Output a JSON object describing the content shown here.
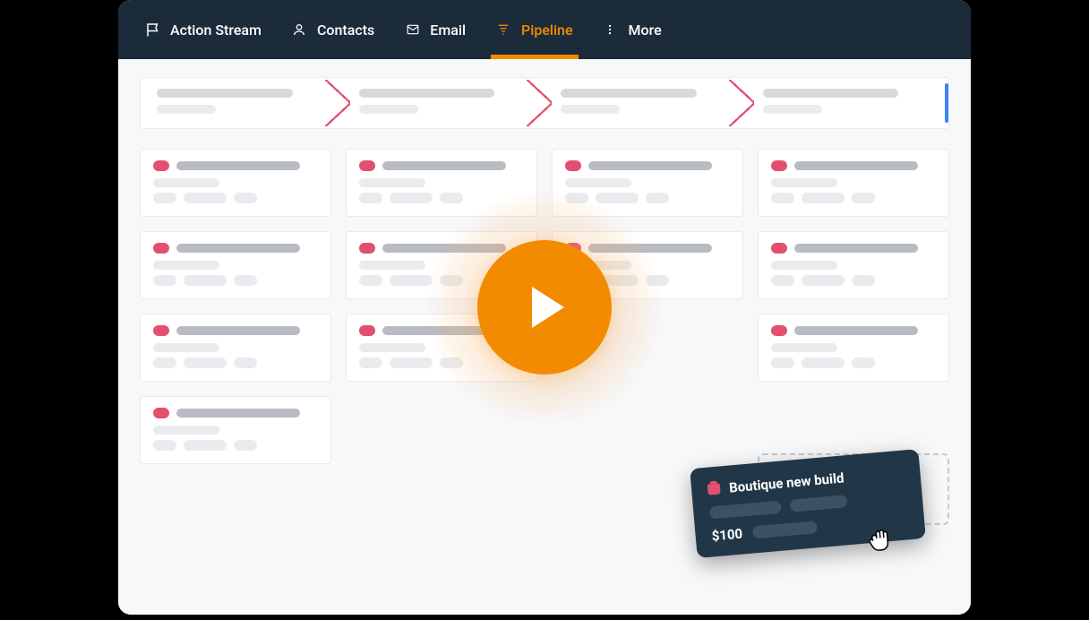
{
  "nav": {
    "items": [
      {
        "id": "action-stream",
        "label": "Action Stream",
        "icon": "flag-icon",
        "active": false
      },
      {
        "id": "contacts",
        "label": "Contacts",
        "icon": "person-icon",
        "active": false
      },
      {
        "id": "email",
        "label": "Email",
        "icon": "envelope-icon",
        "active": false
      },
      {
        "id": "pipeline",
        "label": "Pipeline",
        "icon": "funnel-icon",
        "active": true
      },
      {
        "id": "more",
        "label": "More",
        "icon": "dots-vertical-icon",
        "active": false
      }
    ]
  },
  "pipeline": {
    "stages_count": 4,
    "columns": [
      {
        "card_count": 4
      },
      {
        "card_count": 3
      },
      {
        "card_count": 2
      },
      {
        "card_count": 3
      }
    ]
  },
  "drag_card": {
    "title": "Boutique new build",
    "amount": "$100"
  },
  "colors": {
    "nav_bg": "#1c2b3a",
    "accent": "#f38b00",
    "badge": "#e2506f",
    "drag_bg": "#213747"
  }
}
